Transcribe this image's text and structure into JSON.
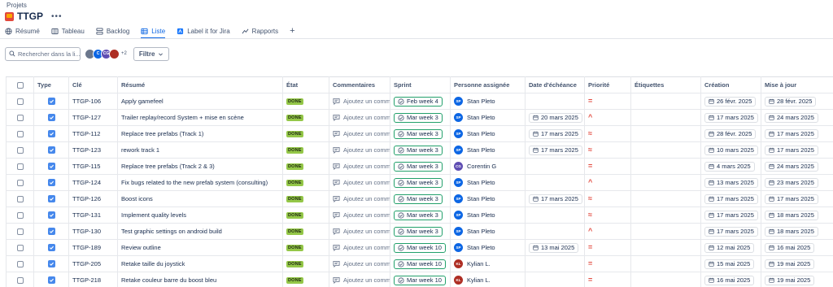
{
  "breadcrumb": "Projets",
  "project": {
    "name": "TTGP",
    "more": "•••"
  },
  "tabs": [
    {
      "label": "Résumé",
      "icon": "globe-icon",
      "active": false
    },
    {
      "label": "Tableau",
      "icon": "board-icon",
      "active": false
    },
    {
      "label": "Backlog",
      "icon": "backlog-icon",
      "active": false
    },
    {
      "label": "Liste",
      "icon": "list-icon",
      "active": true
    },
    {
      "label": "Label it for Jira",
      "icon": "label-icon",
      "active": false
    },
    {
      "label": "Rapports",
      "icon": "chart-icon",
      "active": false
    }
  ],
  "tab_add": "+",
  "search": {
    "placeholder": "Rechercher dans la li..."
  },
  "avatars": [
    {
      "initials": "",
      "color": "#6b778c"
    },
    {
      "initials": "C",
      "color": "#0c66e4"
    },
    {
      "initials": "CG",
      "color": "#5e4db2"
    },
    {
      "initials": "",
      "color": "#ae2e24"
    }
  ],
  "avatars_more": "+2",
  "filter": {
    "label": "Filtre"
  },
  "columns": [
    "",
    "Type",
    "Clé",
    "Résumé",
    "État",
    "Commentaires",
    "Sprint",
    "Personne assignée",
    "Date d'échéance",
    "Priorité",
    "Étiquettes",
    "Création",
    "Mise à jour"
  ],
  "status_colors": {
    "done": "#94c748"
  },
  "rows": [
    {
      "key": "TTGP-106",
      "summary": "Apply gamefeel",
      "status": "DONE",
      "comment": "Ajoutez un comm",
      "sprint": "Feb week 4",
      "assignee": "Stan Pleto",
      "assignee_initials": "SP",
      "assignee_color": "#0c66e4",
      "due": "",
      "priority": "=",
      "labels": "",
      "created": "26 févr. 2025",
      "updated": "28 févr. 2025"
    },
    {
      "key": "TTGP-127",
      "summary": "Trailer replay/record System + mise en scène",
      "status": "DONE",
      "comment": "Ajoutez un comm",
      "sprint": "Mar week 3",
      "assignee": "Stan Pleto",
      "assignee_initials": "SP",
      "assignee_color": "#0c66e4",
      "due": "20 mars 2025",
      "priority": "^",
      "labels": "",
      "created": "17 mars 2025",
      "updated": "24 mars 2025"
    },
    {
      "key": "TTGP-112",
      "summary": "Replace tree prefabs (Track 1)",
      "status": "DONE",
      "comment": "Ajoutez un comm",
      "sprint": "Mar week 3",
      "assignee": "Stan Pleto",
      "assignee_initials": "SP",
      "assignee_color": "#0c66e4",
      "due": "17 mars 2025",
      "priority": "≈",
      "labels": "",
      "created": "28 févr. 2025",
      "updated": "17 mars 2025"
    },
    {
      "key": "TTGP-123",
      "summary": "rework track 1",
      "status": "DONE",
      "comment": "Ajoutez un comm",
      "sprint": "Mar week 3",
      "assignee": "Stan Pleto",
      "assignee_initials": "SP",
      "assignee_color": "#0c66e4",
      "due": "17 mars 2025",
      "priority": "≈",
      "labels": "",
      "created": "10 mars 2025",
      "updated": "17 mars 2025"
    },
    {
      "key": "TTGP-115",
      "summary": "Replace tree prefabs (Track 2 & 3)",
      "status": "DONE",
      "comment": "Ajoutez un comm",
      "sprint": "Mar week 3",
      "assignee": "Corentin G",
      "assignee_initials": "CG",
      "assignee_color": "#5e4db2",
      "due": "",
      "priority": "=",
      "labels": "",
      "created": "4 mars 2025",
      "updated": "24 mars 2025"
    },
    {
      "key": "TTGP-124",
      "summary": "Fix bugs related to the new prefab system (consulting)",
      "status": "DONE",
      "comment": "Ajoutez un comm",
      "sprint": "Mar week 3",
      "assignee": "Stan Pleto",
      "assignee_initials": "SP",
      "assignee_color": "#0c66e4",
      "due": "",
      "priority": "^",
      "labels": "",
      "created": "13 mars 2025",
      "updated": "23 mars 2025"
    },
    {
      "key": "TTGP-126",
      "summary": "Boost icons",
      "status": "DONE",
      "comment": "Ajoutez un comm",
      "sprint": "Mar week 3",
      "assignee": "Stan Pleto",
      "assignee_initials": "SP",
      "assignee_color": "#0c66e4",
      "due": "17 mars 2025",
      "priority": "≈",
      "labels": "",
      "created": "17 mars 2025",
      "updated": "17 mars 2025"
    },
    {
      "key": "TTGP-131",
      "summary": "Implement quality levels",
      "status": "DONE",
      "comment": "Ajoutez un comm",
      "sprint": "Mar week 3",
      "assignee": "Stan Pleto",
      "assignee_initials": "SP",
      "assignee_color": "#0c66e4",
      "due": "",
      "priority": "≈",
      "labels": "",
      "created": "17 mars 2025",
      "updated": "18 mars 2025"
    },
    {
      "key": "TTGP-130",
      "summary": "Test graphic settings on android build",
      "status": "DONE",
      "comment": "Ajoutez un comm",
      "sprint": "Mar week 3",
      "assignee": "Stan Pleto",
      "assignee_initials": "SP",
      "assignee_color": "#0c66e4",
      "due": "",
      "priority": "^",
      "labels": "",
      "created": "17 mars 2025",
      "updated": "18 mars 2025"
    },
    {
      "key": "TTGP-189",
      "summary": "Review outline",
      "status": "DONE",
      "comment": "Ajoutez un comm",
      "sprint": "Mar week 10",
      "assignee": "Stan Pleto",
      "assignee_initials": "SP",
      "assignee_color": "#0c66e4",
      "due": "13 mai 2025",
      "priority": "=",
      "labels": "",
      "created": "12 mai 2025",
      "updated": "16 mai 2025"
    },
    {
      "key": "TTGP-205",
      "summary": "Retake taille du joystick",
      "status": "DONE",
      "comment": "Ajoutez un comm",
      "sprint": "Mar week 10",
      "assignee": "Kylian L.",
      "assignee_initials": "KL",
      "assignee_color": "#ae2e24",
      "due": "",
      "priority": "=",
      "labels": "",
      "created": "15 mai 2025",
      "updated": "19 mai 2025"
    },
    {
      "key": "TTGP-218",
      "summary": "Retake couleur barre du boost bleu",
      "status": "DONE",
      "comment": "Ajoutez un comm",
      "sprint": "Mar week 10",
      "assignee": "Kylian L.",
      "assignee_initials": "KL",
      "assignee_color": "#ae2e24",
      "due": "",
      "priority": "=",
      "labels": "",
      "created": "16 mai 2025",
      "updated": "19 mai 2025"
    }
  ]
}
